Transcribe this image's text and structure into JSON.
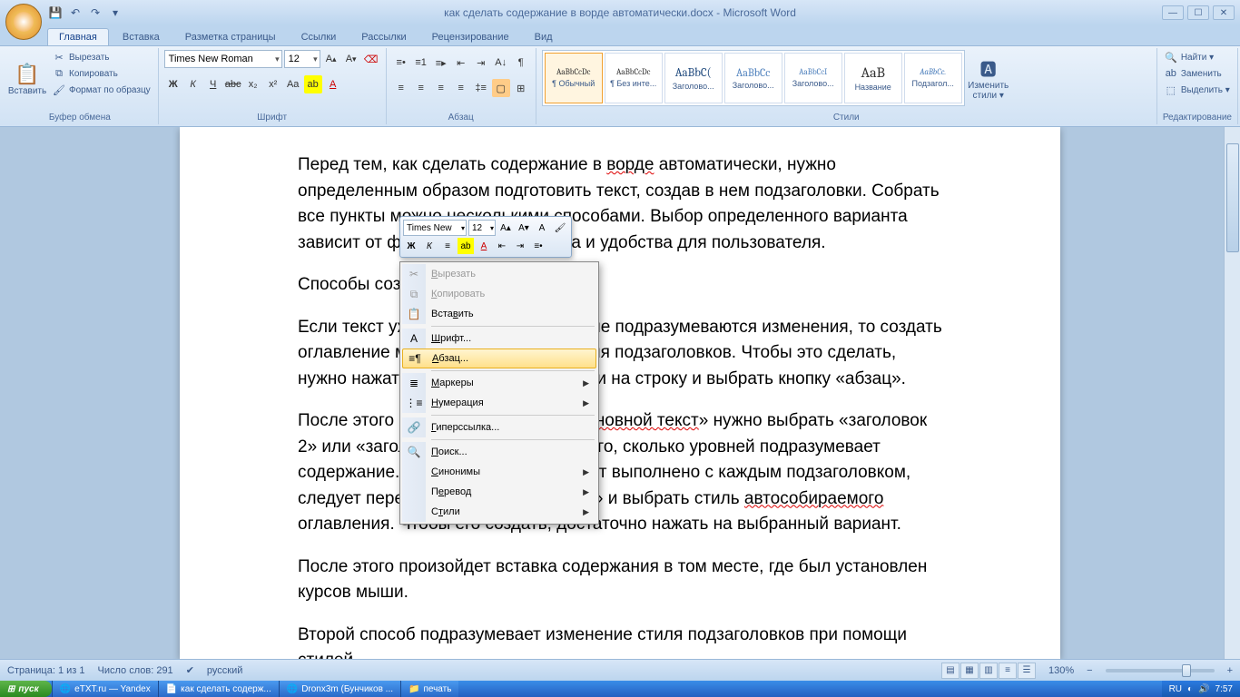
{
  "title": "как сделать содержание в ворде автоматически.docx - Microsoft Word",
  "tabs": [
    "Главная",
    "Вставка",
    "Разметка страницы",
    "Ссылки",
    "Рассылки",
    "Рецензирование",
    "Вид"
  ],
  "clipboard": {
    "paste": "Вставить",
    "cut": "Вырезать",
    "copy": "Копировать",
    "format_painter": "Формат по образцу",
    "title": "Буфер обмена"
  },
  "font": {
    "title": "Шрифт",
    "name": "Times New Roman",
    "size": "12"
  },
  "paragraph": {
    "title": "Абзац"
  },
  "styles": {
    "title": "Стили",
    "change": "Изменить стили ▾",
    "items": [
      {
        "preview": "AaBbCcDc",
        "label": "¶ Обычный"
      },
      {
        "preview": "AaBbCcDc",
        "label": "¶ Без инте..."
      },
      {
        "preview": "AaBbC(",
        "label": "Заголово..."
      },
      {
        "preview": "AaBbCc",
        "label": "Заголово..."
      },
      {
        "preview": "AaBbCcI",
        "label": "Заголово..."
      },
      {
        "preview": "AaB",
        "label": "Название"
      },
      {
        "preview": "AaBbCc.",
        "label": "Подзагол..."
      }
    ]
  },
  "editing": {
    "find": "Найти ▾",
    "replace": "Заменить",
    "select": "Выделить ▾",
    "title": "Редактирование"
  },
  "mini": {
    "font": "Times New",
    "size": "12"
  },
  "context": [
    {
      "icon": "✂",
      "label": "Вырезать",
      "disabled": true,
      "u": "В"
    },
    {
      "icon": "⧉",
      "label": "Копировать",
      "disabled": true,
      "u": "К"
    },
    {
      "icon": "📋",
      "label": "Вставить",
      "u": "в"
    },
    {
      "sep": true
    },
    {
      "icon": "A",
      "label": "Шрифт...",
      "u": "Ш"
    },
    {
      "icon": "≡¶",
      "label": "Абзац...",
      "hover": true,
      "u": "А"
    },
    {
      "sep": true
    },
    {
      "icon": "≣",
      "label": "Маркеры",
      "arrow": true,
      "u": "М"
    },
    {
      "icon": "⋮≡",
      "label": "Нумерация",
      "arrow": true,
      "u": "Н"
    },
    {
      "sep": true
    },
    {
      "icon": "🔗",
      "label": "Гиперссылка...",
      "u": "Г"
    },
    {
      "sep": true
    },
    {
      "icon": "🔍",
      "label": "Поиск...",
      "u": "П"
    },
    {
      "icon": "",
      "label": "Синонимы",
      "arrow": true,
      "u": "С"
    },
    {
      "icon": "",
      "label": "Перевод",
      "arrow": true,
      "u": "е"
    },
    {
      "icon": "",
      "label": "Стили",
      "arrow": true,
      "u": "т"
    }
  ],
  "doc": {
    "p1a": "Перед тем, как сделать содержание в ",
    "p1b": "ворде",
    "p1c": " автоматически, нужно определенным образом подготовить текст, создав в нем подзаголовки. Собрать все пункты можно несколькими способами. Выбор определенного варианта зависит от форматирования текста и удобства для пользователя.",
    "p2": "Способы создания содержания",
    "p3": "Если текст уже набран полностью и не подразумеваются изменения, то создать оглавление можно зависимо от уровня подзаголовков. Чтобы это сделать, нужно нажать правой клавишей мыши на строку и выбрать кнопку «абзац».",
    "p4a": "После этого в строке с надписью «",
    "p4b": "основной текст",
    "p4c": "» нужно выбрать «заголовок 2» или «заголовок 3», зависимо от того, сколько уровней подразумевает содержание. После того, как это будет выполнено с каждым подзаголовком, следует перейти во вкладку «ссылки» и выбрать стиль ",
    "p4d": "автособираемого",
    "p4e": " оглавления. Чтобы его создать, достаточно нажать на выбранный вариант.",
    "p5": "После этого произойдет вставка содержания в том месте, где был установлен курсов мыши.",
    "p6": "Второй способ подразумевает изменение стиля подзаголовков при помощи стилей"
  },
  "status": {
    "page": "Страница: 1 из 1",
    "words": "Число слов: 291",
    "lang": "русский",
    "zoom": "130%"
  },
  "taskbar": {
    "start": "пуск",
    "items": [
      "eTXT.ru — Yandex",
      "как сделать содерж...",
      "Dronx3m (Бунчиков ...",
      "печать"
    ],
    "lang": "RU",
    "time": "7:57"
  }
}
